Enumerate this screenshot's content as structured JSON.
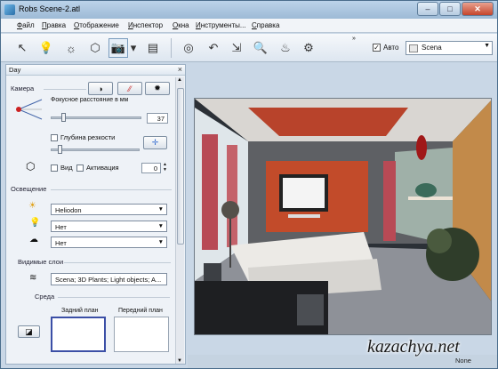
{
  "window": {
    "title": "Robs Scene-2.atl",
    "minimize": "–",
    "maximize": "□",
    "close": "✕"
  },
  "menu": [
    {
      "label": "Файл",
      "key": "Ф",
      "rest": "айл"
    },
    {
      "label": "Правка",
      "key": "П",
      "rest": "равка"
    },
    {
      "label": "Отображение",
      "key": "О",
      "rest": "тображение"
    },
    {
      "label": "Инспектор",
      "key": "И",
      "rest": "нспектор"
    },
    {
      "label": "Окна",
      "key": "О",
      "rest": "кна"
    },
    {
      "label": "Инструменты...",
      "key": "И",
      "rest": "нструменты..."
    },
    {
      "label": "Справка",
      "key": "С",
      "rest": "правка"
    }
  ],
  "toolbar": {
    "icons": [
      "pointer-icon",
      "light-bulb-icon",
      "sun-icon",
      "cube-icon",
      "camera-icon",
      "dropdown-arrow-icon",
      "document-icon",
      "globe-icon",
      "undo-icon",
      "import-icon",
      "magnify-icon",
      "teapot-icon",
      "settings-icon"
    ],
    "overflow": "»",
    "auto_checked": "✓",
    "auto_label": "Авто",
    "scene_select": "Scena"
  },
  "panel": {
    "title": "Day",
    "close": "×",
    "camera": {
      "section": "Камера",
      "focal_label": "Фокусное расстояние в мм",
      "focal_value": "37",
      "dof_label": "Глубина резкости",
      "view_label": "Вид",
      "activation_label": "Активация",
      "activation_value": "0"
    },
    "lighting": {
      "section": "Освещение",
      "sun_value": "Heliodon",
      "light_value": "Нет",
      "sky_value": "Нет"
    },
    "layers": {
      "section": "Видимые слои",
      "value": "Scena; 3D Plants; Light objects; A..."
    },
    "environment": {
      "section": "Среда",
      "back_label": "Задний план",
      "front_label": "Передний план"
    }
  },
  "status": {
    "text": "None"
  },
  "watermark": "kazachya.net"
}
